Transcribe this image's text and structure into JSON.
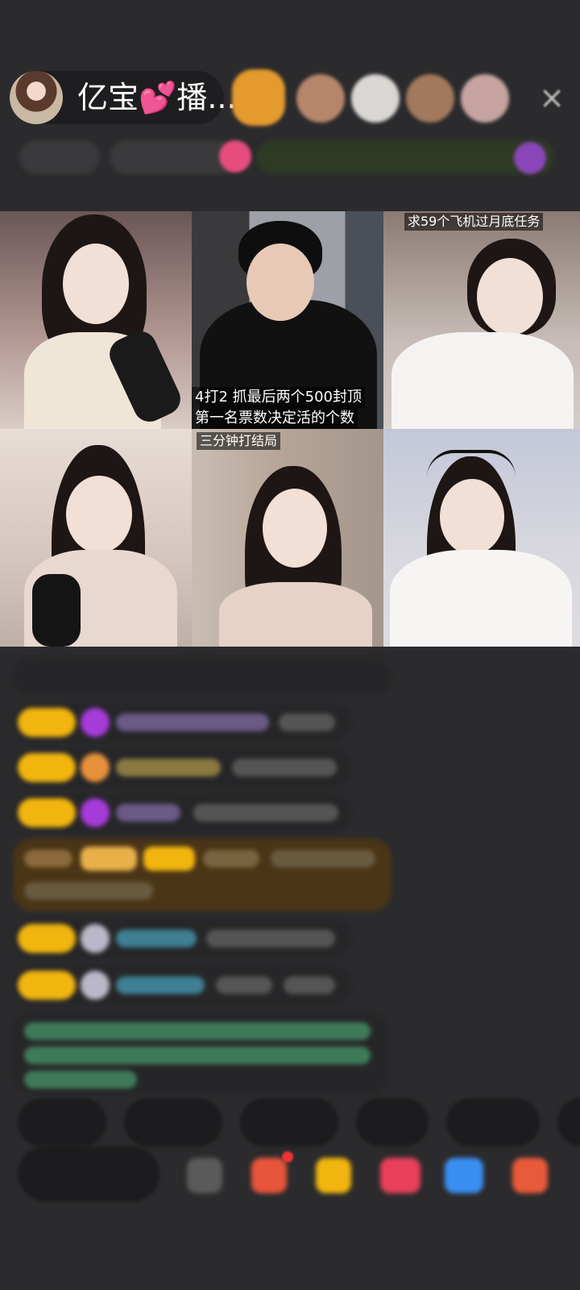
{
  "header": {
    "host_name": "亿宝💕播...",
    "close_icon": "×",
    "viewer_avatar_colors": [
      "#e59a2e",
      "#b6866b",
      "#d9d6d4",
      "#a2795d",
      "#c6a3a0"
    ]
  },
  "video_grid": {
    "tiles": [
      {
        "caption": ""
      },
      {
        "caption_line1": "4打2  抓最后两个500封顶",
        "caption_line2": "第一名票数决定活的个数"
      },
      {
        "caption": "求59个飞机过月底任务"
      },
      {
        "caption": ""
      },
      {
        "caption": "三分钟打结局"
      },
      {
        "caption": ""
      }
    ]
  },
  "colors": {
    "background": "#2b2b2d",
    "badge_yellow": "#f2b50f",
    "gift_purple": "#a63bd9",
    "gold_banner": "#4a3516",
    "chat_green": "#6fd39a",
    "chat_blue": "#5cc6e0"
  },
  "icons": {
    "close": "close-icon",
    "gift": "gift-icon",
    "more": "more-icon"
  }
}
